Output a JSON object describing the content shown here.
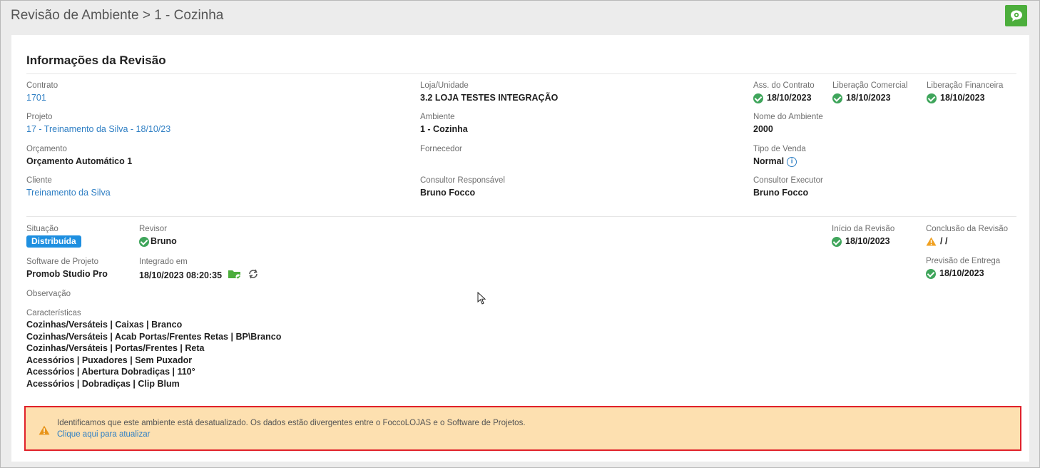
{
  "header": {
    "title": "Revisão de Ambiente > 1 - Cozinha"
  },
  "section": {
    "title": "Informações da Revisão"
  },
  "info": {
    "contrato": {
      "label": "Contrato",
      "value": "1701"
    },
    "projeto": {
      "label": "Projeto",
      "value": "17 - Treinamento da Silva - 18/10/23"
    },
    "orcamento": {
      "label": "Orçamento",
      "value": "Orçamento Automático 1"
    },
    "cliente": {
      "label": "Cliente",
      "value": "Treinamento da Silva"
    },
    "loja": {
      "label": "Loja/Unidade",
      "value": "3.2 LOJA TESTES INTEGRAÇÃO"
    },
    "ambiente": {
      "label": "Ambiente",
      "value": "1 - Cozinha"
    },
    "fornecedor": {
      "label": "Fornecedor",
      "value": ""
    },
    "consultor_resp": {
      "label": "Consultor Responsável",
      "value": "Bruno Focco"
    },
    "ass_contrato": {
      "label": "Ass. do Contrato",
      "value": "18/10/2023"
    },
    "lib_comercial": {
      "label": "Liberação Comercial",
      "value": "18/10/2023"
    },
    "lib_financeira": {
      "label": "Liberação Financeira",
      "value": "18/10/2023"
    },
    "nome_ambiente": {
      "label": "Nome do Ambiente",
      "value": "2000"
    },
    "tipo_venda": {
      "label": "Tipo de Venda",
      "value": "Normal"
    },
    "consultor_exec": {
      "label": "Consultor Executor",
      "value": "Bruno Focco"
    }
  },
  "review": {
    "situacao": {
      "label": "Situação",
      "value": "Distribuída"
    },
    "revisor": {
      "label": "Revisor",
      "value": "Bruno"
    },
    "software": {
      "label": "Software de Projeto",
      "value": "Promob Studio Pro"
    },
    "integrado": {
      "label": "Integrado em",
      "value": "18/10/2023 08:20:35"
    },
    "observacao": {
      "label": "Observação"
    },
    "inicio": {
      "label": "Início da Revisão",
      "value": "18/10/2023"
    },
    "conclusao": {
      "label": "Conclusão da Revisão",
      "value": "/ /"
    },
    "previsao": {
      "label": "Previsão de Entrega",
      "value": "18/10/2023"
    },
    "caracteristicas": {
      "label": "Características",
      "items": [
        "Cozinhas/Versáteis | Caixas | Branco",
        "Cozinhas/Versáteis | Acab Portas/Frentes Retas | BP\\Branco",
        "Cozinhas/Versáteis | Portas/Frentes | Reta",
        "Acessórios | Puxadores | Sem Puxador",
        "Acessórios | Abertura Dobradiças | 110°",
        "Acessórios | Dobradiças | Clip Blum"
      ]
    }
  },
  "alert": {
    "message": "Identificamos que este ambiente está desatualizado. Os dados estão divergentes entre o FoccoLOJAS e o Software de Projetos.",
    "link": "Clique aqui para atualizar"
  },
  "colors": {
    "accent": "#2f7fc4",
    "success": "#3fa55b",
    "badge": "#1e8fe0",
    "warning": "#f0a020",
    "alert_bg": "#fde0b0",
    "alert_border": "#e0212a",
    "top_button": "#4cae3c"
  },
  "icons": [
    "chat-icon",
    "check-circle-icon",
    "info-icon",
    "warning-icon",
    "folder-check-icon",
    "refresh-icon",
    "mouse-cursor-icon"
  ]
}
